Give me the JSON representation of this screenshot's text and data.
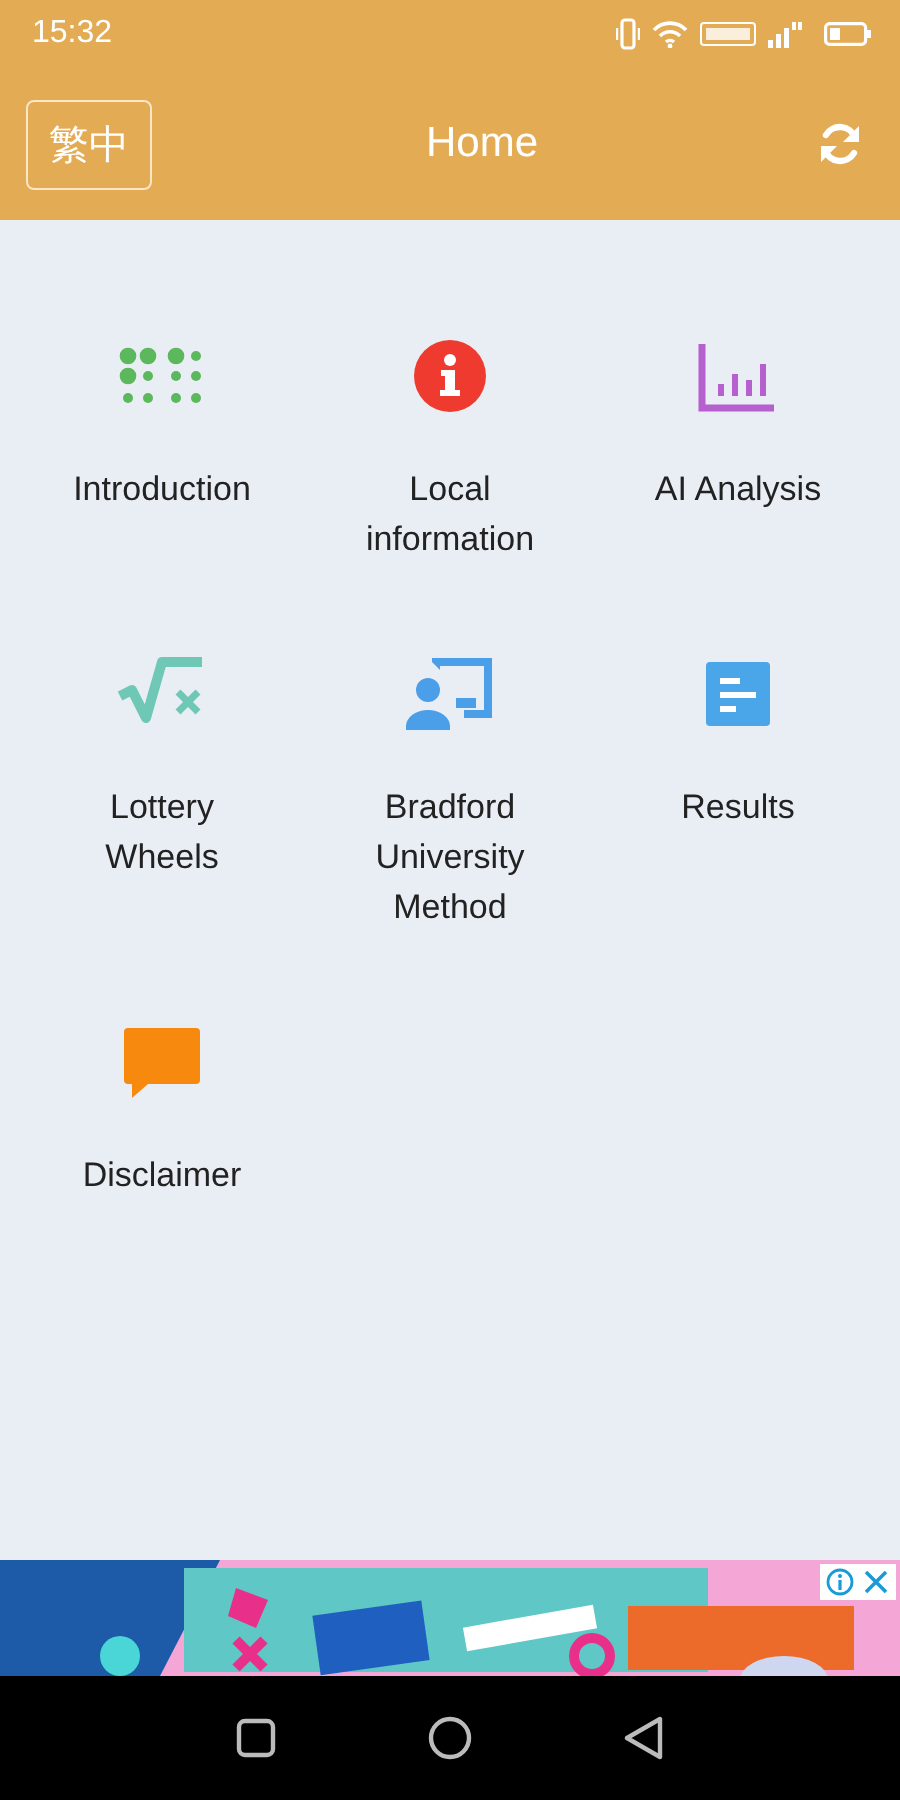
{
  "status_bar": {
    "time": "15:32"
  },
  "header": {
    "language_button": "繁中",
    "title": "Home"
  },
  "menu": [
    {
      "kind": "dots",
      "label": "Introduction"
    },
    {
      "kind": "info",
      "label": "Local information"
    },
    {
      "kind": "chart",
      "label": "AI Analysis"
    },
    {
      "kind": "sqrt",
      "label": "Lottery Wheels"
    },
    {
      "kind": "teacher",
      "label": "Bradford University Method"
    },
    {
      "kind": "doc",
      "label": "Results"
    },
    {
      "kind": "chat",
      "label": "Disclaimer"
    }
  ]
}
